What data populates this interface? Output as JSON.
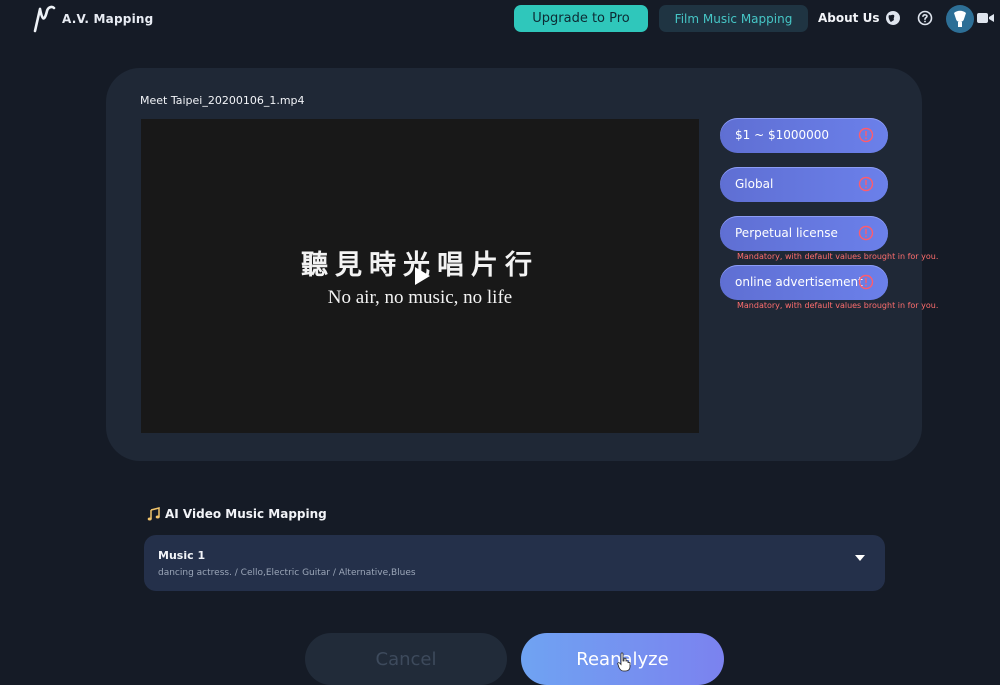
{
  "nav": {
    "brand": "A.V. Mapping",
    "upgrade_label": "Upgrade to Pro",
    "film_mapping_label": "Film Music Mapping",
    "about_label": "About Us",
    "icons": [
      "globe-icon",
      "help-icon",
      "avatar",
      "video-camera-icon"
    ]
  },
  "video": {
    "filename": "Meet Taipei_20200106_1.mp4",
    "overlay_cjk": "聽見時光唱片行",
    "overlay_subtitle": "No air, no music, no life"
  },
  "params": [
    {
      "label": "$1 ~ $1000000",
      "mandatory_note": ""
    },
    {
      "label": "Global",
      "mandatory_note": ""
    },
    {
      "label": "Perpetual license",
      "mandatory_note": "Mandatory, with default values brought in for you."
    },
    {
      "label": "online advertisement",
      "mandatory_note": "Mandatory, with default values brought in for you."
    }
  ],
  "mapping": {
    "section_title": "AI Video Music Mapping",
    "music_title": "Music 1",
    "music_desc": "dancing actress. / Cello,Electric Guitar / Alternative,Blues"
  },
  "actions": {
    "cancel_label": "Cancel",
    "reanalyze_label": "Reanalyze"
  },
  "colors": {
    "accent_teal": "#2fc7bb",
    "pill_blue": "#6b80ea",
    "warning_red": "#ff6e6e",
    "background": "#151b26"
  }
}
